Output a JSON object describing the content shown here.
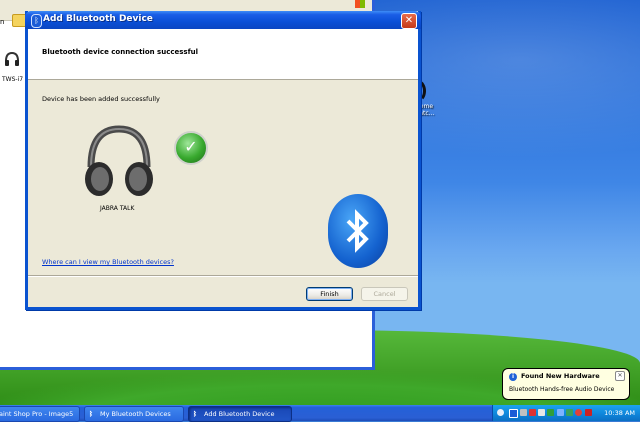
{
  "background_window": {
    "toolbar_text": "n",
    "device_label": "TWS-i7"
  },
  "desktop": {
    "icon_label_line1": "heme",
    "icon_label_line2": "Patc..."
  },
  "dialog": {
    "title": "Add Bluetooth Device",
    "header_title": "Bluetooth device connection successful",
    "body_message": "Device has been added successfully",
    "device_name": "JABRA TALK",
    "help_link": "Where can I view my Bluetooth devices?",
    "finish_label": "Finish",
    "cancel_label": "Cancel",
    "close_glyph": "✕"
  },
  "balloon": {
    "title": "Found New Hardware",
    "body": "Bluetooth Hands-free Audio Device",
    "info_glyph": "i",
    "close_glyph": "✕"
  },
  "taskbar": {
    "buttons": [
      {
        "label": "aint Shop Pro - Image5",
        "icon": "paint-icon",
        "active": false
      },
      {
        "label": "My Bluetooth Devices",
        "icon": "bluetooth-icon",
        "active": false
      },
      {
        "label": "Add Bluetooth Device",
        "icon": "bluetooth-icon",
        "active": true
      }
    ],
    "clock": "10:38 AM"
  },
  "colors": {
    "title_blue": "#0a4fd6",
    "link_blue": "#0033cc",
    "taskbar_blue": "#2a5fd4",
    "tray_blue": "#0e84d9",
    "balloon_bg": "#ffffe1"
  }
}
